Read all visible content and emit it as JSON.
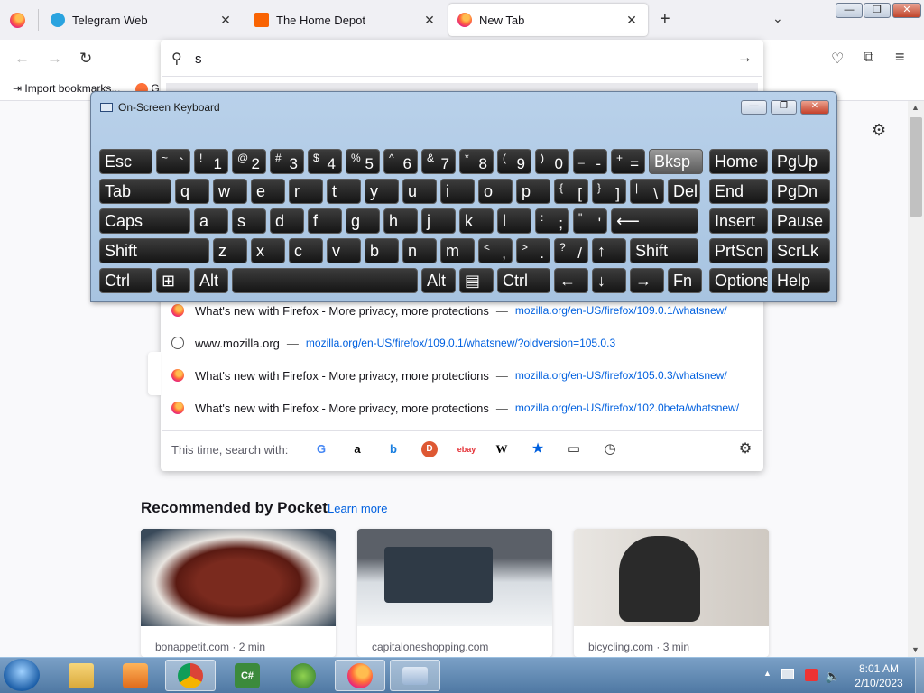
{
  "browser": {
    "tabs": [
      {
        "label": "Telegram Web",
        "close": "✕"
      },
      {
        "label": "The Home Depot",
        "close": "✕"
      },
      {
        "label": "New Tab",
        "close": "✕"
      }
    ],
    "new_tab": "+",
    "list_all": "⌄",
    "window_buttons": {
      "minimize": "—",
      "maximize": "❐",
      "close": "✕"
    }
  },
  "navbar": {
    "back_icon": "←",
    "forward_icon": "→",
    "reload_icon": "↻",
    "url_value": "s",
    "go_icon": "→",
    "pocket_icon": "♡",
    "extensions_icon": "⧉",
    "menu_icon": "≡"
  },
  "bookmarks": {
    "import": "Import bookmarks...",
    "partial": "G"
  },
  "suggestions": [
    {
      "title_a": "What's",
      "title_b": "new with Firefox - More privacy, more protections",
      "url": "mozilla.org/en-US/firefox/109.0.1/whatsnew/"
    },
    {
      "title_a": "www.mozilla.org",
      "title_b": "",
      "url": "mozilla.org/en-US/firefox/109.0.1/whatsnew/?oldversion=105.0.3"
    },
    {
      "title_a": "What's",
      "title_b": "new with Firefox - More privacy, more protections",
      "url": "mozilla.org/en-US/firefox/105.0.3/whatsnew/"
    },
    {
      "title_a": "What's",
      "title_b": "new with Firefox - More privacy, more protections",
      "url": "mozilla.org/en-US/firefox/102.0beta/whatsnew/"
    }
  ],
  "search_with": {
    "label": "This time, search with:",
    "engines": [
      "G",
      "a",
      "b",
      "D",
      "ebay",
      "W",
      "★",
      "▭",
      "◷"
    ],
    "gear": "⚙"
  },
  "page": {
    "gear": "⚙",
    "pocket_title": "Recommended by Pocket",
    "pocket_learn": "Learn more",
    "cards": [
      {
        "source": "bonappetit.com · 2 min"
      },
      {
        "source": "capitaloneshopping.com"
      },
      {
        "source": "bicycling.com · 3 min"
      }
    ]
  },
  "osk": {
    "title": "On-Screen Keyboard",
    "minimize": "—",
    "restore": "❐",
    "close": "✕",
    "row1": [
      {
        "label": "Esc"
      },
      {
        "sup": "~",
        "main": "`"
      },
      {
        "sup": "!",
        "main": "1"
      },
      {
        "sup": "@",
        "main": "2"
      },
      {
        "sup": "#",
        "main": "3"
      },
      {
        "sup": "$",
        "main": "4"
      },
      {
        "sup": "%",
        "main": "5"
      },
      {
        "sup": "^",
        "main": "6"
      },
      {
        "sup": "&",
        "main": "7"
      },
      {
        "sup": "*",
        "main": "8"
      },
      {
        "sup": "(",
        "main": "9"
      },
      {
        "sup": ")",
        "main": "0"
      },
      {
        "sup": "_",
        "main": "-"
      },
      {
        "sup": "+",
        "main": "="
      },
      {
        "label": "Bksp"
      },
      {
        "label": "Home"
      },
      {
        "label": "PgUp"
      }
    ],
    "row2": [
      "Tab",
      "q",
      "w",
      "e",
      "r",
      "t",
      "y",
      "u",
      "i",
      "o",
      "p",
      "[",
      "]",
      "\\",
      "Del",
      "End",
      "PgDn"
    ],
    "row2_sup": {
      "[": "{",
      "]": "}",
      "\\": "|"
    },
    "row3": [
      "Caps",
      "a",
      "s",
      "d",
      "f",
      "g",
      "h",
      "j",
      "k",
      "l",
      ";",
      "'",
      "⟵",
      "Insert",
      "Pause"
    ],
    "row3_sup": {
      ";": ":",
      "'": "\""
    },
    "row4": [
      "Shift",
      "z",
      "x",
      "c",
      "v",
      "b",
      "n",
      "m",
      ",",
      ".",
      "/",
      "↑",
      "Shift",
      "PrtScn",
      "ScrLk"
    ],
    "row4_sup": {
      ",": "<",
      ".": ">",
      "/": "?"
    },
    "row5": [
      "Ctrl",
      "⊞",
      "Alt",
      "",
      "Alt",
      "▤",
      "Ctrl",
      "←",
      "↓",
      "→",
      "Fn",
      "Options",
      "Help"
    ]
  },
  "taskbar": {
    "time": "8:01 AM",
    "date": "2/10/2023",
    "tray_arrow": "▲"
  }
}
